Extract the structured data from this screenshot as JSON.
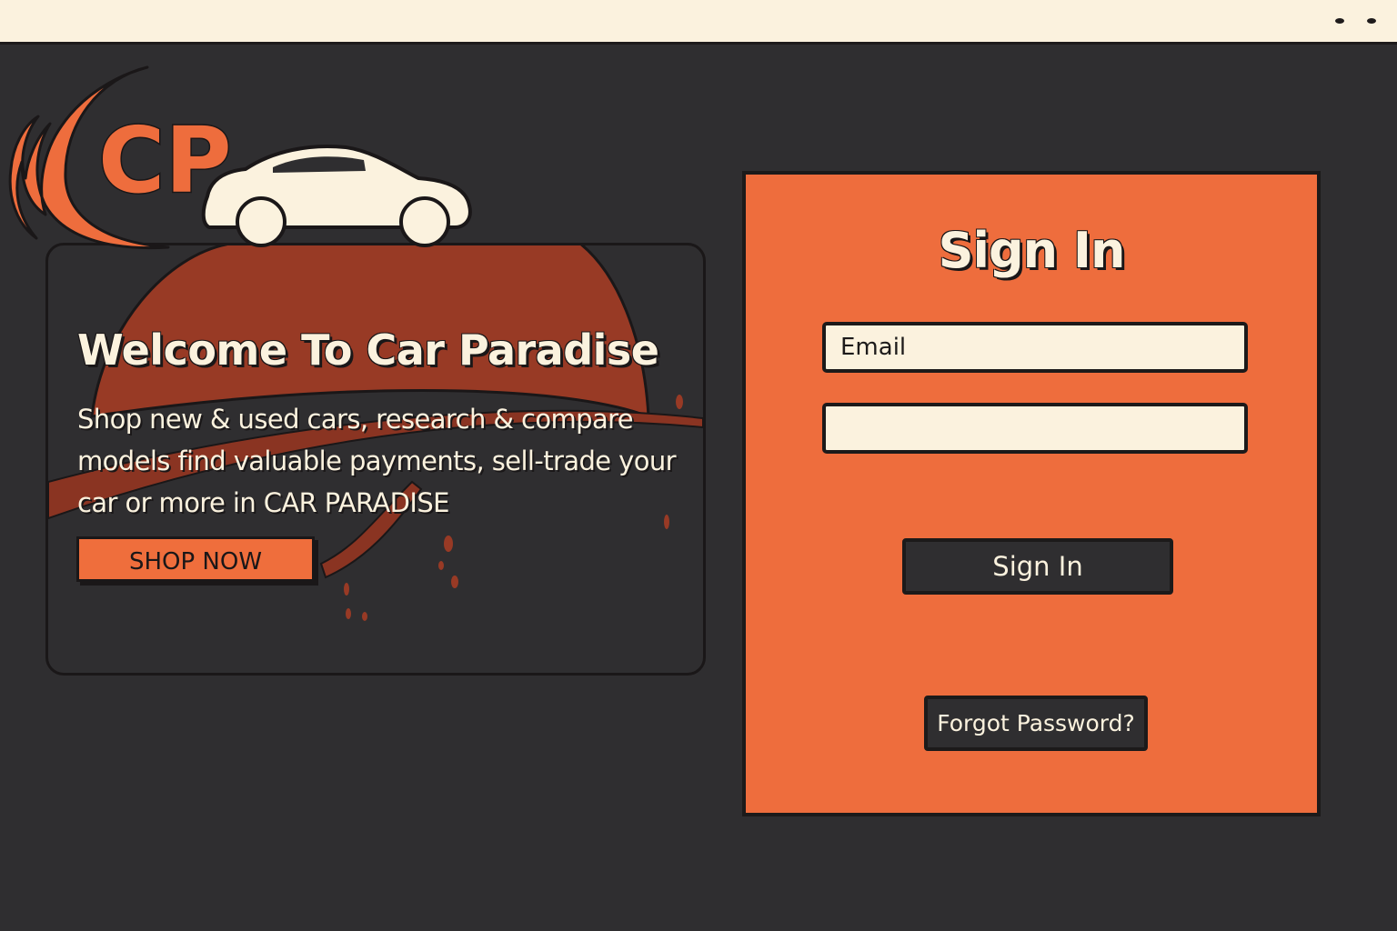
{
  "brand": {
    "logo_text": "CP",
    "accent_color": "#ee6d3d",
    "dark_color": "#2f2e30",
    "cream_color": "#fbf2de"
  },
  "hero": {
    "title": "Welcome To Car Paradise",
    "description": "Shop new & used cars, research & compare models find valuable payments, sell-trade your car or more in CAR PARADISE",
    "cta_label": "SHOP NOW"
  },
  "signin": {
    "title": "Sign In",
    "email_placeholder": "Email",
    "password_placeholder": "",
    "submit_label": "Sign In",
    "forgot_label": "Forgot Password?"
  }
}
